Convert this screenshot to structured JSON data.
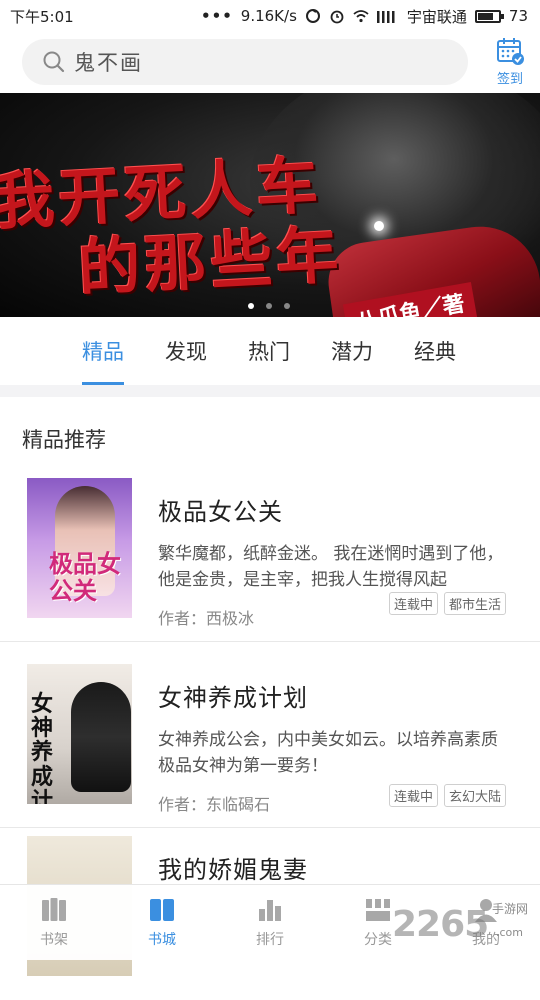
{
  "status_bar": {
    "time": "下午5:01",
    "dots": "•••",
    "speed": "9.16K/s",
    "carrier": "宇宙联通",
    "battery": "73"
  },
  "search": {
    "placeholder": "鬼不画",
    "signin_label": "签到"
  },
  "banner": {
    "title_line1": "我开死人车",
    "title_line2": "的那些年",
    "author_tag": "八爪鱼／著",
    "active_dot": 0,
    "dot_count": 3
  },
  "tabs": [
    {
      "label": "精品",
      "active": true
    },
    {
      "label": "发现",
      "active": false
    },
    {
      "label": "热门",
      "active": false
    },
    {
      "label": "潜力",
      "active": false
    },
    {
      "label": "经典",
      "active": false
    }
  ],
  "section": {
    "title": "精品推荐"
  },
  "books": [
    {
      "title": "极品女公关",
      "desc": "繁华魔都，纸醉金迷。 我在迷惘时遇到了他，他是金贵，是主宰，把我人生搅得风起",
      "author": "作者：西极冰",
      "tags": [
        "连载中",
        "都市生活"
      ],
      "cover_text": "极品女公关"
    },
    {
      "title": "女神养成计划",
      "desc": "女神养成公会，内中美女如云。以培养高素质极品女神为第一要务！",
      "author": "作者：东临碣石",
      "tags": [
        "连载中",
        "玄幻大陆"
      ],
      "cover_text": "女神养成计划"
    },
    {
      "title": "我的娇媚鬼妻",
      "desc": "",
      "author": "",
      "tags": [],
      "cover_text": ""
    }
  ],
  "bottom_nav": [
    {
      "label": "书架",
      "icon": "bookshelf-icon",
      "active": false
    },
    {
      "label": "书城",
      "icon": "bookstore-icon",
      "active": true
    },
    {
      "label": "排行",
      "icon": "ranking-icon",
      "active": false
    },
    {
      "label": "分类",
      "icon": "category-icon",
      "active": false
    },
    {
      "label": "我的",
      "icon": "profile-icon",
      "active": false
    }
  ],
  "watermark": {
    "brand": "2265",
    "top": "手游网",
    "bottom": ".com"
  },
  "colors": {
    "accent": "#3b8fe0",
    "banner_red": "#c4161c"
  }
}
